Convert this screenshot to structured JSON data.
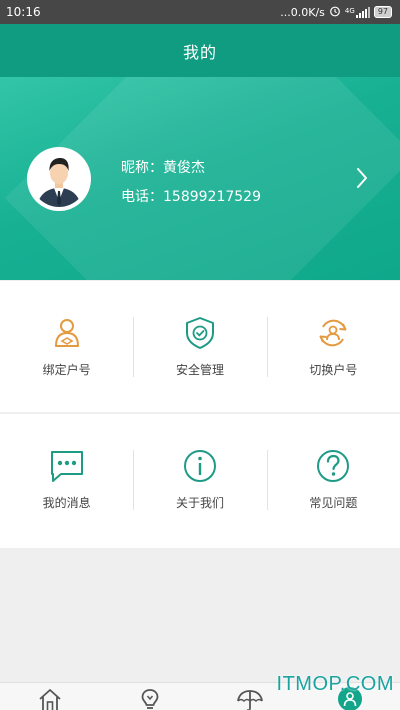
{
  "status_bar": {
    "time": "10:16",
    "network_speed": "...0.0K/s",
    "signal_label": "4G",
    "battery": "97"
  },
  "header": {
    "title": "我的"
  },
  "profile": {
    "nickname_label": "昵称：",
    "nickname": "黄俊杰",
    "phone_label": "电话：",
    "phone": "15899217529"
  },
  "section_1": [
    {
      "label": "绑定户号",
      "icon": "person-icon"
    },
    {
      "label": "安全管理",
      "icon": "shield-icon"
    },
    {
      "label": "切换户号",
      "icon": "switch-user-icon"
    }
  ],
  "section_2": [
    {
      "label": "我的消息",
      "icon": "message-icon"
    },
    {
      "label": "关于我们",
      "icon": "info-icon"
    },
    {
      "label": "常见问题",
      "icon": "question-icon"
    }
  ],
  "tabbar": {
    "tabs": [
      {
        "icon": "home-icon"
      },
      {
        "icon": "bulb-icon"
      },
      {
        "icon": "umbrella-icon"
      },
      {
        "icon": "profile-icon",
        "active": true
      }
    ]
  },
  "watermark": "ITMOP.COM",
  "colors": {
    "header": "#0f9c80",
    "orange_icon": "#e49a3f",
    "teal_icon": "#1f9b85",
    "active_tab": "#12a58a"
  }
}
